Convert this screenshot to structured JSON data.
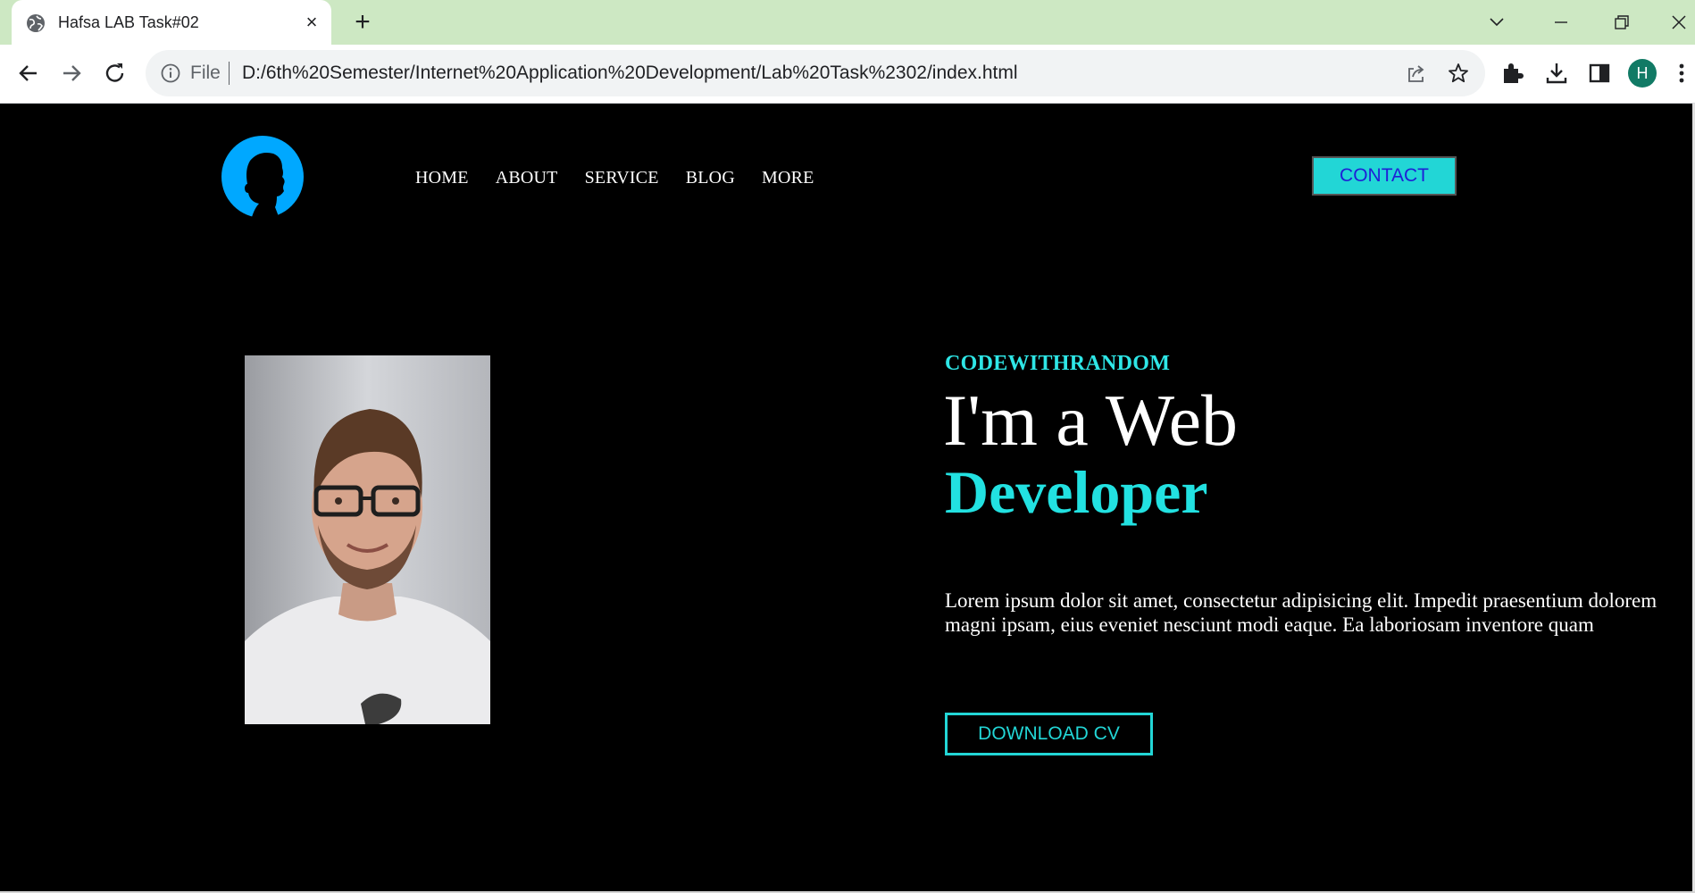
{
  "browser": {
    "tab_title": "Hafsa LAB Task#02",
    "tab_icon": "globe-icon",
    "new_tab": "+",
    "close_tab": "×",
    "omnibox": {
      "scheme": "File",
      "url": "D:/6th%20Semester/Internet%20Application%20Development/Lab%20Task%2302/index.html"
    },
    "profile_initial": "H",
    "colors": {
      "tabstrip": "#cde8c3",
      "profile": "#117a65"
    }
  },
  "page": {
    "nav": {
      "items": [
        {
          "label": "HOME"
        },
        {
          "label": "ABOUT"
        },
        {
          "label": "SERVICE"
        },
        {
          "label": "BLOG"
        },
        {
          "label": "MORE"
        }
      ],
      "contact_label": "CONTACT"
    },
    "hero": {
      "tagline": "CODEWITHRANDOM",
      "line1": "I'm a Web",
      "line2": "Developer",
      "blurb": "Lorem ipsum dolor sit amet, consectetur adipisicing elit. Impedit praesentium dolorem magni ipsam, eius eveniet nesciunt modi eaque. Ea laboriosam inventore quam",
      "cta_label": "DOWNLOAD CV"
    },
    "colors": {
      "background": "#000000",
      "accent": "#22d6d6",
      "logo": "#00a8ff"
    }
  }
}
